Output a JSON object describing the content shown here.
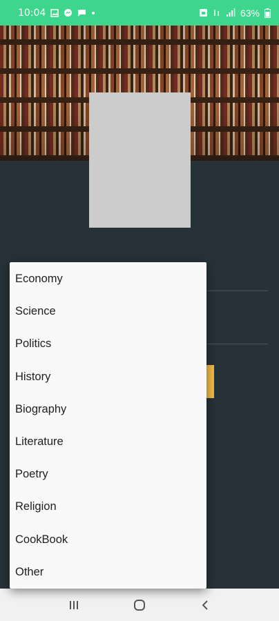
{
  "status_bar": {
    "time": "10:04",
    "battery": "63%",
    "background_color": "#3dd68c",
    "left_icons": [
      "image-icon",
      "messenger-icon",
      "chat-icon",
      "dot-icon"
    ],
    "right_icons": [
      "alarm-icon",
      "wifi-calling-icon",
      "signal-icon",
      "battery-icon"
    ]
  },
  "header": {
    "image_description_icon": "bookshelf-image"
  },
  "cover": {
    "color": "#cccccc"
  },
  "dropdown": {
    "options": [
      "Economy",
      "Science",
      "Politics",
      "History",
      "Biography",
      "Literature",
      "Poetry",
      "Religion",
      "CookBook",
      "Other"
    ]
  },
  "nav_bar": {
    "buttons": [
      "recent-apps-icon",
      "home-icon",
      "back-icon"
    ]
  },
  "colors": {
    "background": "#263238",
    "accent_button": "#f0b845",
    "dropdown_bg": "#f9f9f9"
  }
}
